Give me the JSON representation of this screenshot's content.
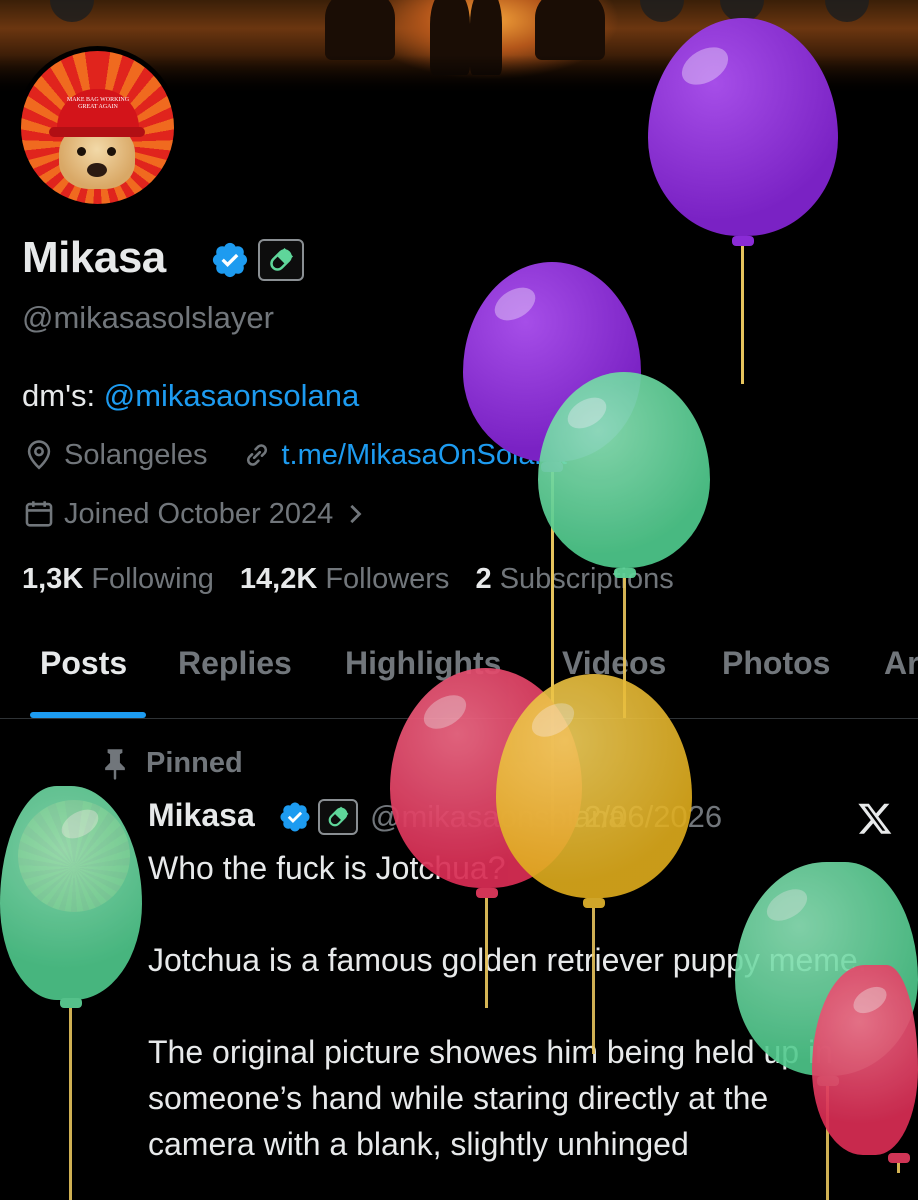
{
  "profile": {
    "name": "Mikasa",
    "handle": "@mikasasolslayer",
    "bio_prefix": "dm's: ",
    "bio_mention": "@mikasaonsolana",
    "location": "Solangeles",
    "link": "t.me/MikasaOnSolana",
    "joined": "Joined October 2024",
    "avatar_hat_text": "MAKE BAG WORKING GREAT AGAIN"
  },
  "stats": {
    "following_count": "1,3K",
    "following_label": "Following",
    "followers_count": "14,2K",
    "followers_label": "Followers",
    "subscriptions_count": "2",
    "subscriptions_label": "Subscriptions"
  },
  "tabs": [
    {
      "label": "Posts",
      "active": true
    },
    {
      "label": "Replies"
    },
    {
      "label": "Highlights"
    },
    {
      "label": "Videos"
    },
    {
      "label": "Photos"
    },
    {
      "label": "Ar"
    }
  ],
  "post": {
    "pinned_label": "Pinned",
    "author": "Mikasa",
    "handle": "@mikasaonsolana",
    "date": "12/06/2026",
    "paragraphs": [
      "Who the fuck is Jotchua?",
      "Jotchua is a famous golden retriever puppy meme.",
      "The original picture showes him being held up in someone’s hand while staring directly at the camera with a blank, slightly unhinged"
    ]
  },
  "icons": {
    "verified": "verified-badge-icon",
    "pill": "pill-icon",
    "location": "location-pin-icon",
    "link": "link-icon",
    "calendar": "calendar-icon",
    "chevron": "chevron-right-icon",
    "pin": "pin-icon",
    "x": "x-logo-icon"
  },
  "colors": {
    "accent": "#1d9bf0",
    "muted": "#71767b",
    "text": "#e7e9ea",
    "background": "#000000",
    "balloon_purple": "#8a2bd6",
    "balloon_green": "#5fd69a",
    "balloon_red": "#e23a5e",
    "balloon_yellow": "#e6b72e"
  }
}
